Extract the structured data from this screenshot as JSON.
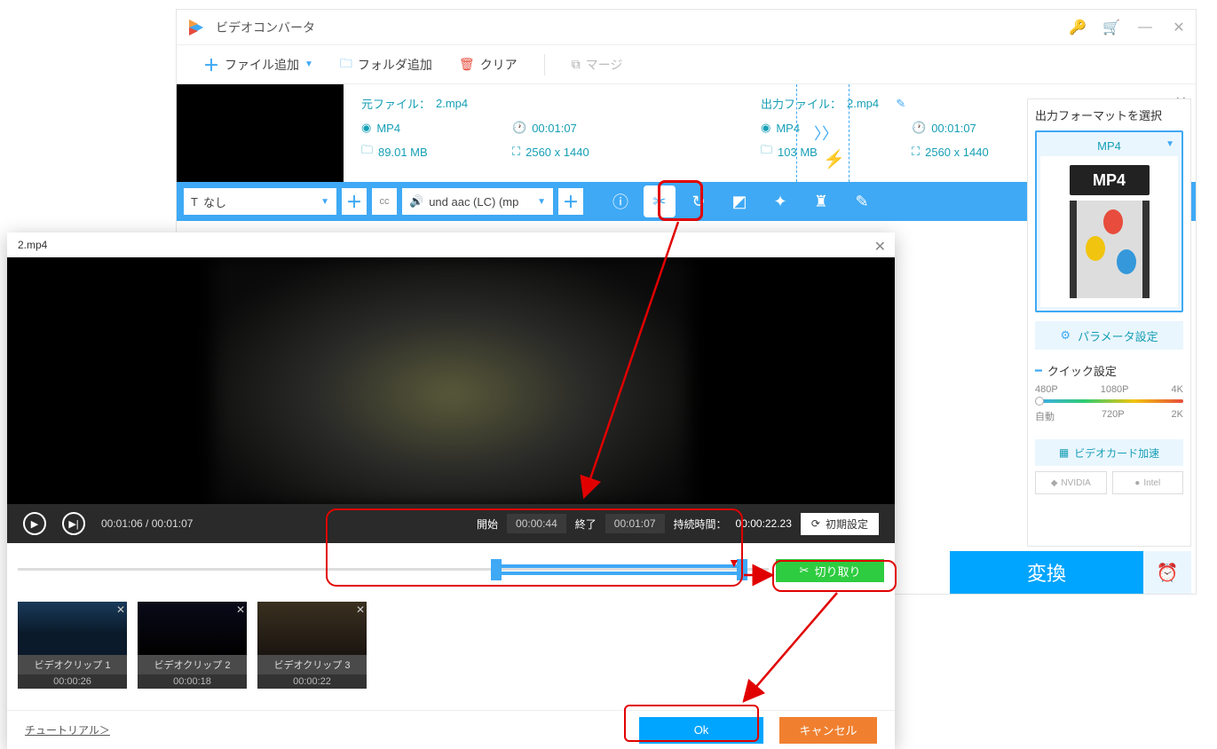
{
  "app": {
    "title": "ビデオコンバータ"
  },
  "toolbar": {
    "addFile": "ファイル追加",
    "addFolder": "フォルダ追加",
    "clear": "クリア",
    "merge": "マージ"
  },
  "file": {
    "srcLabel": "元ファイル：",
    "srcName": "2.mp4",
    "srcFormat": "MP4",
    "srcDuration": "00:01:07",
    "srcSize": "89.01 MB",
    "srcRes": "2560 x 1440",
    "outLabel": "出力ファイル：",
    "outName": "2.mp4",
    "outFormat": "MP4",
    "outDuration": "00:01:07",
    "outSize": "103 MB",
    "outRes": "2560 x 1440"
  },
  "actionBar": {
    "subtitle": "なし",
    "audio": "und aac (LC) (mp"
  },
  "rightPanel": {
    "title": "出力フォーマットを選択",
    "format": "MP4",
    "paramBtn": "パラメータ設定",
    "quickSet": "クイック設定",
    "res": {
      "p480": "480P",
      "p720": "720P",
      "p1080": "1080P",
      "k2": "2K",
      "k4": "4K",
      "auto": "自動"
    },
    "gpuBtn": "ビデオカード加速",
    "nvidia": "NVIDIA",
    "intel": "Intel",
    "convert": "変換"
  },
  "editor": {
    "title": "2.mp4",
    "currentTime": "00:01:06",
    "totalTime": "00:01:07",
    "startLabel": "開始",
    "startVal": "00:00:44",
    "endLabel": "終了",
    "endVal": "00:01:07",
    "durationLabel": "持続時間：",
    "durationVal": "00:00:22.23",
    "resetBtn": "初期設定",
    "cutBtn": "切り取り",
    "tutorial": "チュートリアル＞",
    "ok": "Ok",
    "cancel": "キャンセル"
  },
  "clips": [
    {
      "name": "ビデオクリップ 1",
      "time": "00:00:26"
    },
    {
      "name": "ビデオクリップ 2",
      "time": "00:00:18"
    },
    {
      "name": "ビデオクリップ 3",
      "time": "00:00:22"
    }
  ]
}
